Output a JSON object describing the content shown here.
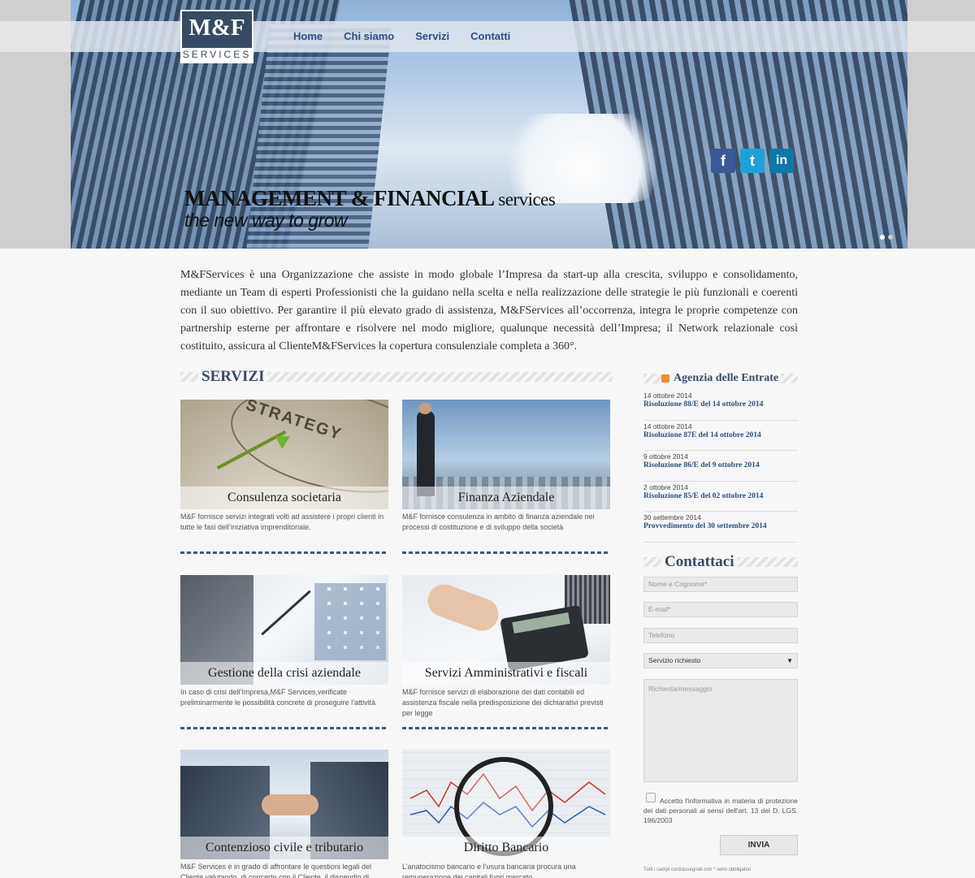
{
  "logo": {
    "line1": "M&F",
    "line2": "SERVICES"
  },
  "nav": [
    {
      "label": "Home"
    },
    {
      "label": "Chi siamo"
    },
    {
      "label": "Servizi"
    },
    {
      "label": "Contatti"
    }
  ],
  "social": [
    {
      "icon": "facebook-icon",
      "glyph": "f",
      "color": "#3b5998"
    },
    {
      "icon": "twitter-icon",
      "glyph": "t",
      "color": "#1ea1d8"
    },
    {
      "icon": "linkedin-icon",
      "glyph": "in",
      "color": "#0e76a8"
    }
  ],
  "hero": {
    "title_main": "MANAGEMENT & FINANCIAL",
    "title_tail": "services",
    "subtitle": "the new way to grow",
    "slides": 2,
    "active_slide": 1
  },
  "intro": "M&FServices è una Organizzazione che assiste in modo globale l’Impresa da start-up alla crescita, sviluppo e consolidamento, mediante un Team di esperti Professionisti che la guidano nella scelta e nella realizzazione delle strategie le più funzionali e coerenti con il suo obiettivo. Per garantire il più elevato grado di assistenza, M&FServices all’occorrenza, integra le proprie competenze con partnership esterne per affrontare e risolvere nel modo migliore, qualunque necessità dell’Impresa; il Network relazionale così costituito, assicura al ClienteM&FServices la copertura consulenziale completa a 360°.",
  "services": {
    "heading": "SERVIZI",
    "items": [
      {
        "title": "Consulenza societaria",
        "desc": "M&F fornisce servizi integrati volti ad assistere i propri clienti in tutte le fasi dell’iniziativa imprenditoriale.",
        "image_text": "STRATEGY"
      },
      {
        "title": "Finanza Aziendale",
        "desc": "M&F fornisce consulenza in ambito di finanza aziendale nei processi di costituzione e di sviluppo della società"
      },
      {
        "title": "Gestione della crisi aziendale",
        "desc": "In caso di crisi dell’Impresa,M&F Services,verificate preliminarmente le possibilità concrete di proseguire l’attività"
      },
      {
        "title": "Servizi Amministrativi e fiscali",
        "desc": "M&F fornisce servizi di elaborazione dei dati contabili ed assistenza fiscale nella predisposizione dei dichiarativi previsti per legge"
      },
      {
        "title": "Contenzioso civile e tributario",
        "desc": "M&F Services è in grado di affrontare le questioni legali del Cliente valutando, di concerto con il Cliente, il dispendio di tempo e risorse"
      },
      {
        "title": "Diritto Bancario",
        "desc": "L’anatocismo bancario e l’usura bancaria procura una remunerazione dei capitali fuori mercato"
      }
    ]
  },
  "feed": {
    "title": "Agenzia delle Entrate",
    "items": [
      {
        "date": "14 ottobre 2014",
        "title": "Risoluzione 88/E del 14 ottobre 2014"
      },
      {
        "date": "14 ottobre 2014",
        "title": "Risoluzione 87E del 14 ottobre 2014"
      },
      {
        "date": "9 ottobre 2014",
        "title": "Risoluzione 86/E del 9 ottobre 2014"
      },
      {
        "date": "2 ottobre 2014",
        "title": "Risoluzione 85/E del 02 ottobre 2014"
      },
      {
        "date": "30 settembre 2014",
        "title": "Provvedimento del 30 settembre 2014"
      }
    ]
  },
  "contact": {
    "title": "Contattaci",
    "name_placeholder": "Nome e Cognome*",
    "email_placeholder": "E-mail*",
    "phone_placeholder": "Telefono",
    "service_select": "Servizio richiesto",
    "message_placeholder": "Richiesta/messaggio",
    "privacy": "Accetto l'informativa in materia di protezione dei dati personali ai sensi dell'art. 13 del D. LGS. 196/2003",
    "submit": "INVIA",
    "note": "Tutti i campi contrassegnati con * sono obbligatori"
  }
}
